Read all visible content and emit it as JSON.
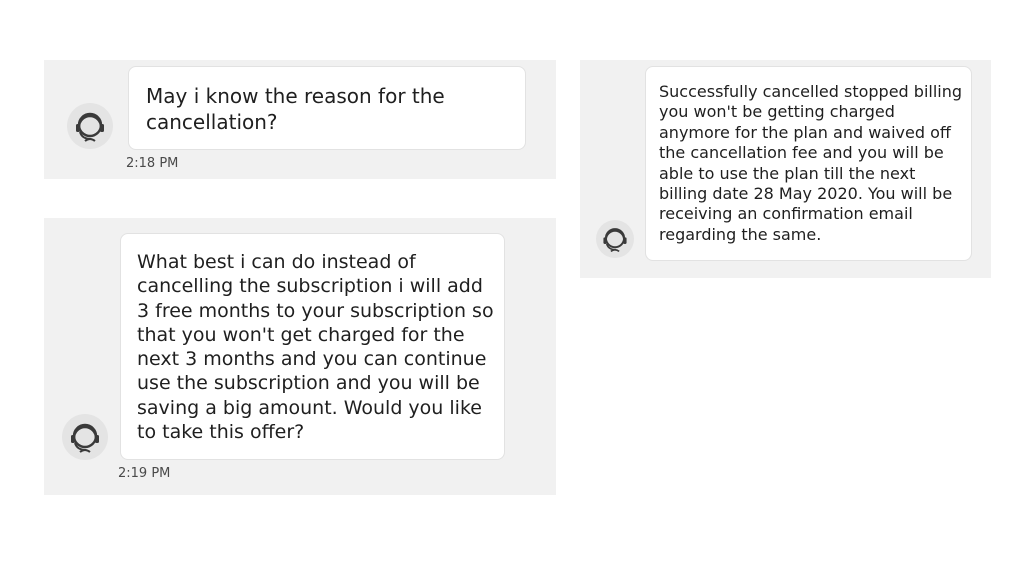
{
  "messages": [
    {
      "text": "May i know the reason for the\ncancellation?",
      "time": "2:18 PM",
      "avatar_icon": "headset-agent-icon"
    },
    {
      "text": "What best i can do instead of\ncancelling the subscription i will add\n3 free months to your subscription so\nthat you won't get charged for the\nnext 3 months and you can continue\nuse the subscription and you will be\nsaving a big amount. Would you like\nto take this offer?",
      "time": "2:19 PM",
      "avatar_icon": "headset-agent-icon"
    },
    {
      "text": "Successfully cancelled stopped billing\nyou won't be getting charged\nanymore for the plan and waived off\nthe cancellation fee and you will be\nable to use the plan till the next\nbilling date 28 May 2020. You will be\nreceiving an confirmation email\nregarding the same.",
      "avatar_icon": "headset-agent-icon"
    }
  ],
  "colors": {
    "panel_background": "#f1f1f1",
    "bubble_background": "#ffffff",
    "text": "#1f1f1f",
    "avatar_background": "#e4e4e4"
  }
}
